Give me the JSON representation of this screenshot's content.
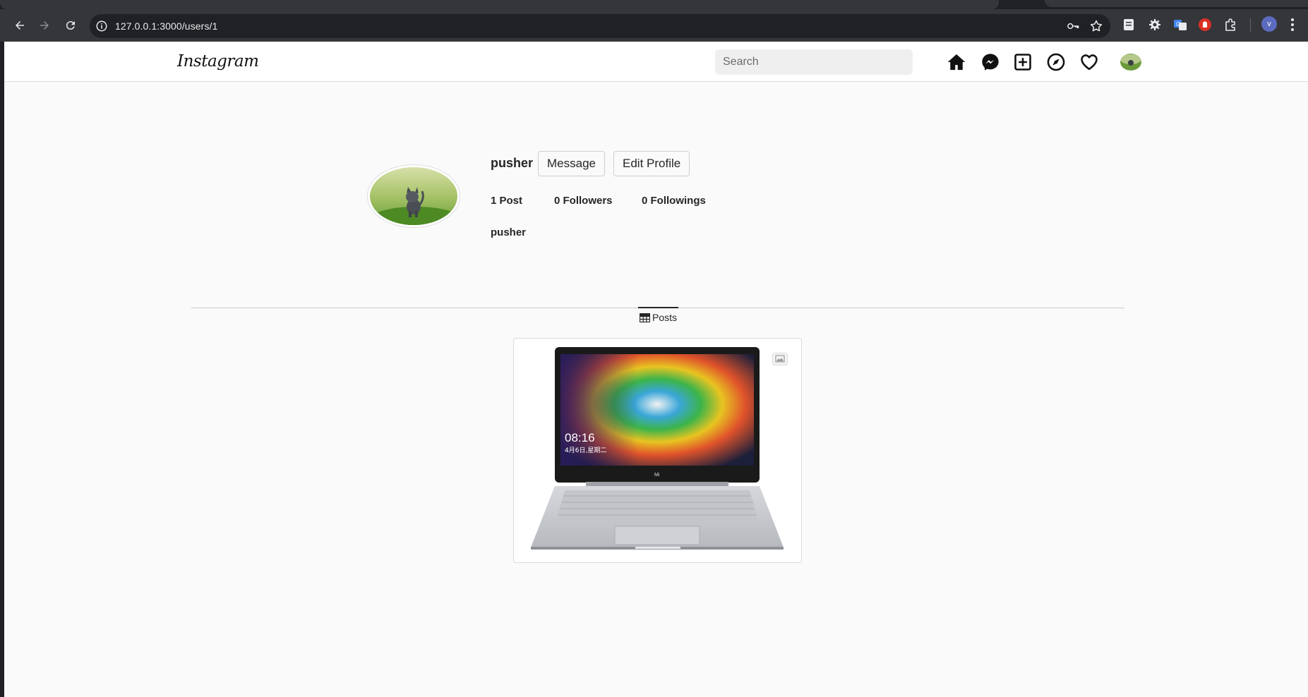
{
  "browser": {
    "url": "127.0.0.1:3000/users/1",
    "profile_initial": "v"
  },
  "navbar": {
    "logo_text": "Instagram",
    "search_placeholder": "Search",
    "icons": [
      "home-icon",
      "messenger-icon",
      "new-post-icon",
      "explore-icon",
      "heart-icon"
    ]
  },
  "profile": {
    "username": "pusher",
    "message_label": "Message",
    "edit_profile_label": "Edit Profile",
    "posts_count": "1 Post",
    "followers_count": "0 Followers",
    "followings_count": "0 Followings",
    "full_name": "pusher"
  },
  "tabs": {
    "posts_label": "Posts"
  },
  "posts": [
    {
      "screen_time": "08:16",
      "screen_date": "4月6日,星期二",
      "brand": "Mi"
    }
  ],
  "colors": {
    "page_bg": "#fafafa",
    "text": "#262626",
    "border": "#dbdbdb",
    "chrome_dark": "#202124",
    "chrome_toolbar": "#35363a"
  }
}
